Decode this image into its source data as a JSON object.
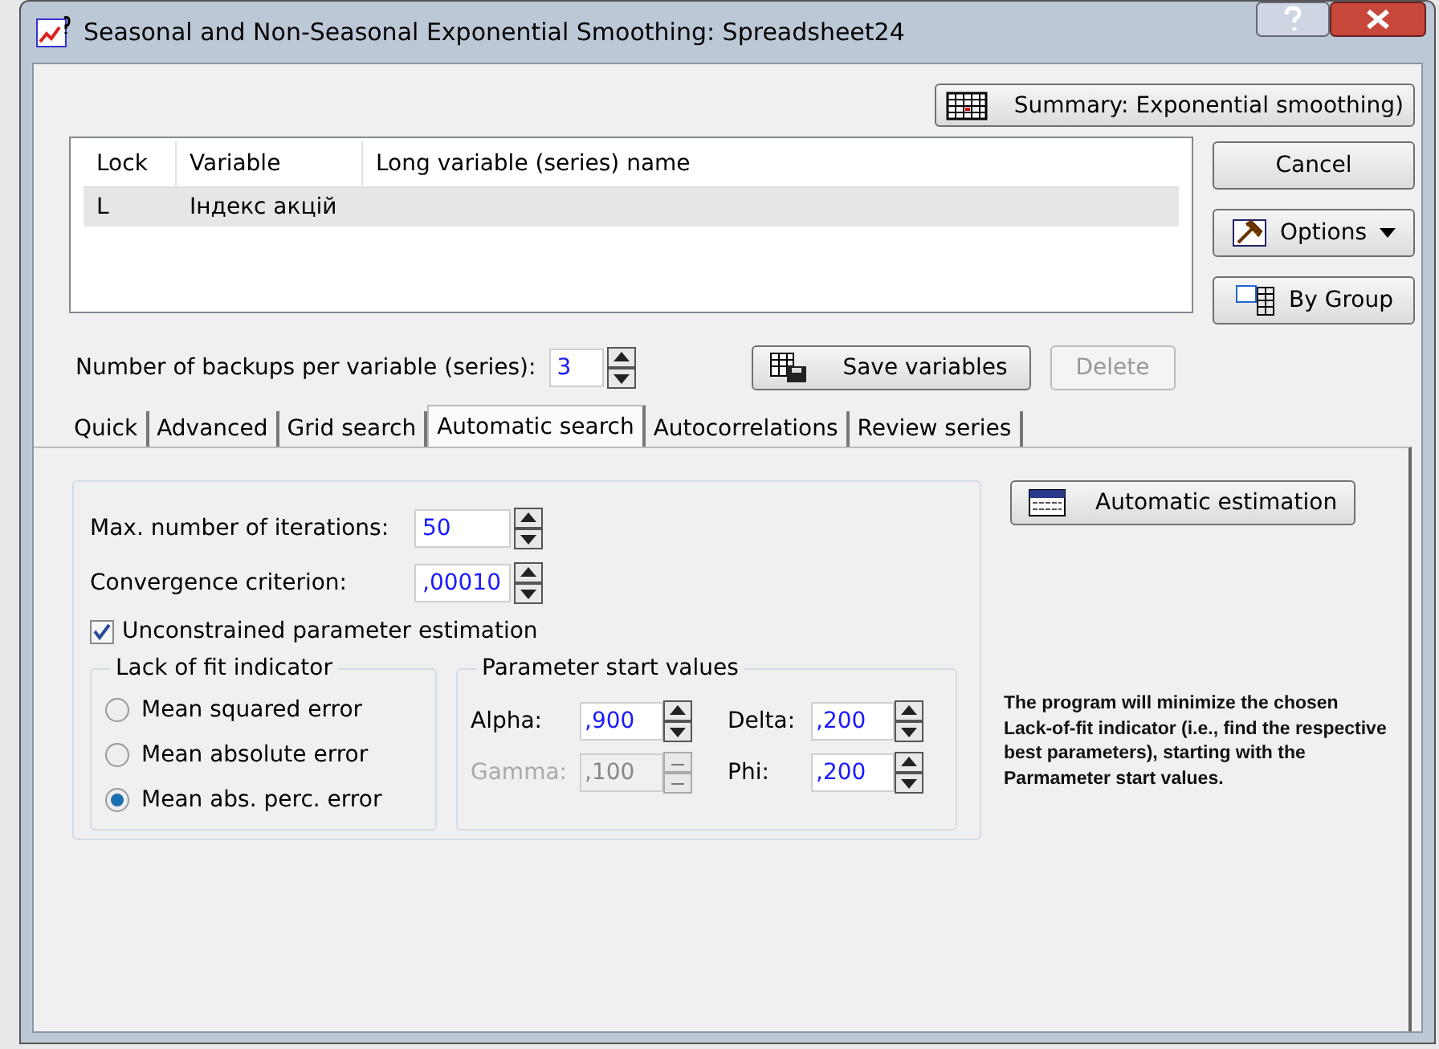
{
  "window": {
    "title": "Seasonal and Non-Seasonal Exponential Smoothing: Spreadsheet24"
  },
  "summary_button": {
    "label": "Summary:  Exponential smoothing)"
  },
  "variables_table": {
    "columns": [
      "Lock",
      "Variable",
      "Long variable (series) name"
    ],
    "rows": [
      {
        "lock": "L",
        "variable": "Індекс акцій",
        "selected": true
      }
    ]
  },
  "side_buttons": [
    {
      "label": "Cancel",
      "kind": "plain"
    },
    {
      "label": "Options",
      "kind": "menu"
    },
    {
      "label": "By Group",
      "kind": "group"
    }
  ],
  "backups": {
    "label": "Number of backups per variable (series):",
    "value": "3"
  },
  "save_button": {
    "label": "Save variables"
  },
  "delete_button": {
    "label": "Delete",
    "disabled": true
  },
  "tabs": [
    {
      "label": "Quick",
      "selected": false
    },
    {
      "label": "Advanced",
      "selected": false
    },
    {
      "label": "Grid search",
      "selected": false
    },
    {
      "label": "Automatic search",
      "selected": true
    },
    {
      "label": "Autocorrelations",
      "selected": false
    },
    {
      "label": "Review series",
      "selected": false
    }
  ],
  "iterations": {
    "label": "Max. number of iterations:",
    "value": "50"
  },
  "convergence": {
    "label": "Convergence criterion:",
    "value": ",00010"
  },
  "unconstrained": {
    "label": "Unconstrained parameter estimation",
    "checked": true
  },
  "lack_of_fit": {
    "title": "Lack of fit indicator",
    "options": [
      {
        "label": "Mean squared error",
        "selected": false
      },
      {
        "label": "Mean absolute error",
        "selected": false
      },
      {
        "label": "Mean abs. perc. error",
        "selected": true
      }
    ]
  },
  "start_values": {
    "title": "Parameter start values",
    "fields": [
      {
        "label": "Alpha:",
        "value": ",900",
        "disabled": false
      },
      {
        "label": "Delta:",
        "value": ",200",
        "disabled": false
      },
      {
        "label": "Gamma:",
        "value": ",100",
        "disabled": true
      },
      {
        "label": "Phi:",
        "value": ",200",
        "disabled": false
      }
    ]
  },
  "automatic_button": {
    "label": "Automatic estimation"
  },
  "note": "The program will minimize the chosen Lack-of-fit indicator (i.e., find the respective best parameters), starting with the Parmameter start values."
}
